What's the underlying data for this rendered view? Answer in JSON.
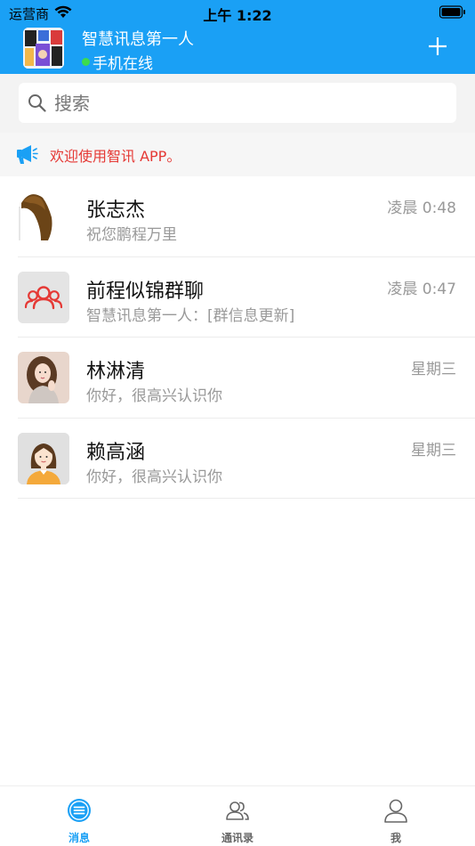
{
  "status_bar": {
    "carrier": "运营商",
    "time": "上午 1:22"
  },
  "header": {
    "profile_name": "智慧讯息第一人",
    "online_status": "手机在线",
    "add_icon": "plus-icon"
  },
  "search": {
    "placeholder": "搜索",
    "value": ""
  },
  "notice": {
    "text": "欢迎使用智讯 APP。",
    "icon": "megaphone-icon"
  },
  "conversations": [
    {
      "name": "张志杰",
      "preview": "祝您鹏程万里",
      "time": "凌晨 0:48"
    },
    {
      "name": "前程似锦群聊",
      "preview": "智慧讯息第一人：[群信息更新]",
      "time": "凌晨 0:47"
    },
    {
      "name": "林淋清",
      "preview": "你好，很高兴认识你",
      "time": "星期三"
    },
    {
      "name": "赖高涵",
      "preview": "你好，很高兴认识你",
      "time": "星期三"
    }
  ],
  "tabs": [
    {
      "label": "消息",
      "icon": "message-icon",
      "active": true
    },
    {
      "label": "通讯录",
      "icon": "contacts-icon",
      "active": false
    },
    {
      "label": "我",
      "icon": "user-icon",
      "active": false
    }
  ],
  "colors": {
    "accent": "#1aa0f5",
    "online": "#3ddc4e",
    "notice_text": "#e53935",
    "group_icon": "#e53935"
  }
}
